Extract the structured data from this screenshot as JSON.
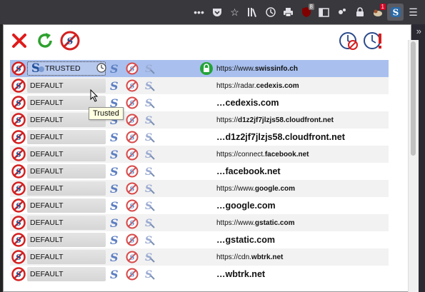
{
  "browser_toolbar": {
    "icons": [
      "more-dots-icon",
      "pocket-icon",
      "bookmark-star-icon",
      "library-icon",
      "history-clock-icon",
      "print-icon",
      "ublock-icon",
      "reader-sidebar-icon",
      "extension-icon",
      "lock-icon",
      "squirrel-icon",
      "noscript-icon",
      "menu-icon"
    ],
    "ublock_badge": "8",
    "squirrel_badge": "1"
  },
  "panel": {
    "toolbar_icons": [
      "close-x-icon",
      "reload-icon",
      "global-noscript-icon",
      "revoke-temporary-icon",
      "temp-trust-page-icon"
    ],
    "tooltip": "Trusted",
    "rows": [
      {
        "level": "TRUSTED",
        "url_prefix": "https://www.",
        "url_domain": "swissinfo.ch",
        "style": "small",
        "selected": true,
        "locked": true
      },
      {
        "level": "DEFAULT",
        "url_prefix": "https://radar.",
        "url_domain": "cedexis.com",
        "style": "small"
      },
      {
        "level": "DEFAULT",
        "url_prefix": "…",
        "url_domain": "cedexis.com",
        "style": "big"
      },
      {
        "level": "DEFAULT",
        "url_prefix": "https://",
        "url_domain": "d1z2jf7jlzjs58.cloudfront.net",
        "style": "small"
      },
      {
        "level": "DEFAULT",
        "url_prefix": "…",
        "url_domain": "d1z2jf7jlzjs58.cloudfront.net",
        "style": "big"
      },
      {
        "level": "DEFAULT",
        "url_prefix": "https://connect.",
        "url_domain": "facebook.net",
        "style": "small"
      },
      {
        "level": "DEFAULT",
        "url_prefix": "…",
        "url_domain": "facebook.net",
        "style": "big"
      },
      {
        "level": "DEFAULT",
        "url_prefix": "https://www.",
        "url_domain": "google.com",
        "style": "small"
      },
      {
        "level": "DEFAULT",
        "url_prefix": "…",
        "url_domain": "google.com",
        "style": "big"
      },
      {
        "level": "DEFAULT",
        "url_prefix": "https://www.",
        "url_domain": "gstatic.com",
        "style": "small"
      },
      {
        "level": "DEFAULT",
        "url_prefix": "…",
        "url_domain": "gstatic.com",
        "style": "big"
      },
      {
        "level": "DEFAULT",
        "url_prefix": "https://cdn.",
        "url_domain": "wbtrk.net",
        "style": "small"
      },
      {
        "level": "DEFAULT",
        "url_prefix": "…",
        "url_domain": "wbtrk.net",
        "style": "big"
      }
    ]
  },
  "colors": {
    "accent_selected": "#a9c0ee",
    "close_red": "#e01b1b",
    "reload_green": "#2ea12e",
    "lock_green": "#25a33a",
    "ban_red": "#d42020"
  }
}
